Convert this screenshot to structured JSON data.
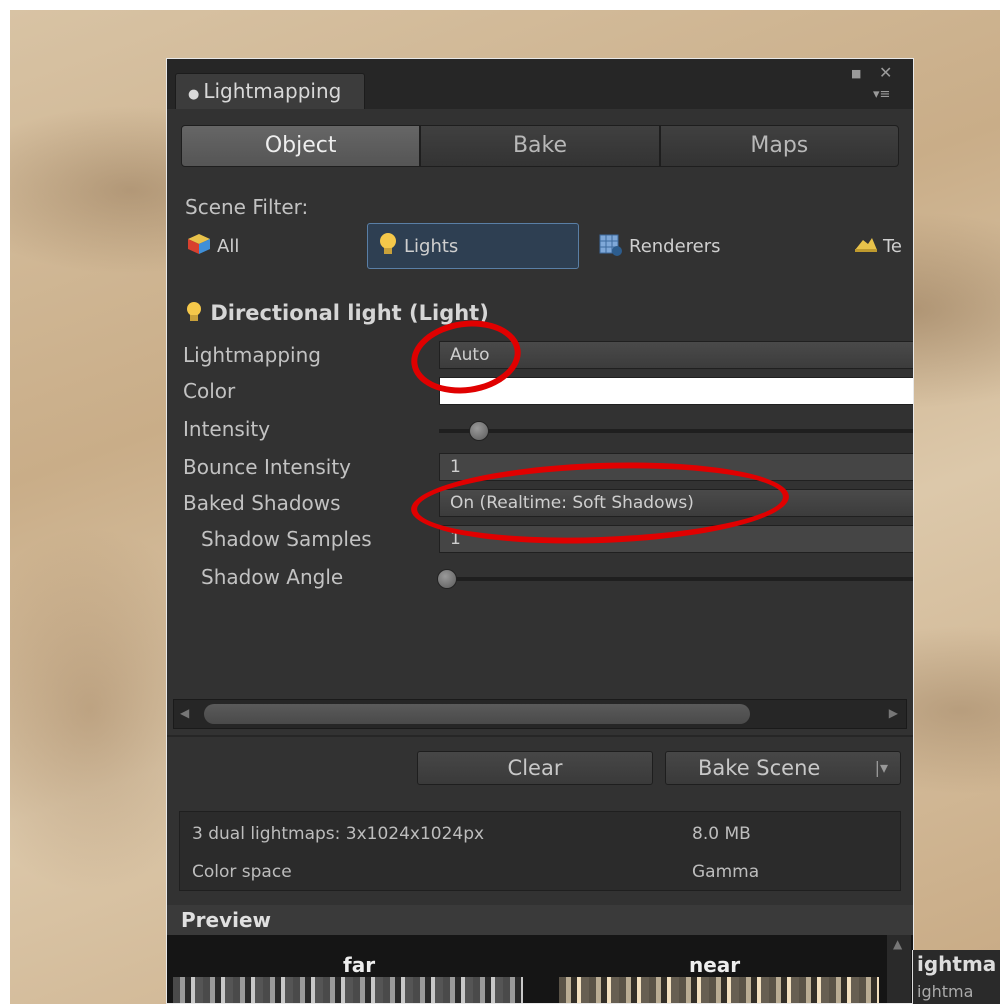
{
  "window": {
    "tab_title": "Lightmapping"
  },
  "toolbar": {
    "tabs": [
      "Object",
      "Bake",
      "Maps"
    ],
    "active": "Object"
  },
  "scene_filter": {
    "label": "Scene Filter:",
    "options": [
      "All",
      "Lights",
      "Renderers",
      "Te"
    ],
    "selected": "Lights"
  },
  "inspector": {
    "title": "Directional light (Light)",
    "rows": {
      "lightmapping": {
        "label": "Lightmapping",
        "value": "Auto"
      },
      "color": {
        "label": "Color",
        "value": "#ffffff"
      },
      "intensity": {
        "label": "Intensity",
        "slider": 0.08
      },
      "bounce": {
        "label": "Bounce Intensity",
        "value": "1"
      },
      "baked_shadows": {
        "label": "Baked Shadows",
        "value": "On (Realtime: Soft Shadows)"
      },
      "shadow_samples": {
        "label": "Shadow Samples",
        "value": "1"
      },
      "shadow_angle": {
        "label": "Shadow Angle",
        "slider": 0.0
      }
    }
  },
  "buttons": {
    "clear": "Clear",
    "bake_scene": "Bake Scene",
    "bake_dropdown": "|▾"
  },
  "stats": {
    "lightmaps": "3 dual lightmaps: 3x1024x1024px",
    "size": "8.0 MB",
    "color_space_label": "Color space",
    "color_space_value": "Gamma"
  },
  "preview": {
    "title": "Preview",
    "far": "far",
    "near": "near"
  },
  "second_window": {
    "title": "ightma",
    "subtitle": "ightma"
  },
  "colors": {
    "annotation": "#e00000",
    "selected_filter": "#2e3f52"
  },
  "icons": {
    "pin": "light-bulb-icon",
    "all": "cube-icon",
    "lights": "light-bulb-icon",
    "renderers": "renderer-icon",
    "terrain": "terrain-icon"
  }
}
